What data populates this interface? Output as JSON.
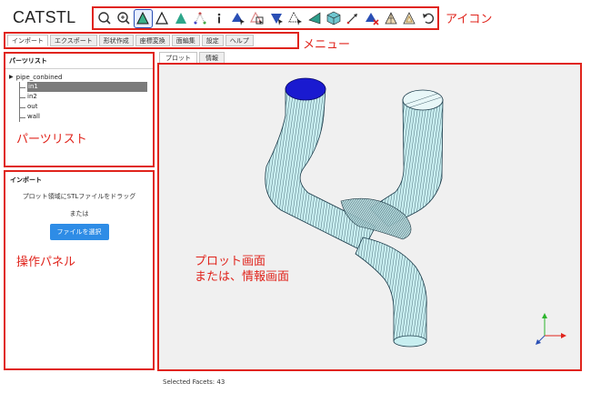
{
  "app": {
    "title": "CATSTL"
  },
  "toolbar": {
    "icons": [
      "zoom-fit-icon",
      "zoom-icon",
      "view-triangle-active-icon",
      "wireframe-triangle-icon",
      "shaded-triangle-icon",
      "point-triangle-icon",
      "info-icon",
      "select-face-icon",
      "select-box-icon",
      "select-flag-icon",
      "select-point-icon",
      "solid-triangle-icon",
      "cube-icon",
      "arrow-icon",
      "delete-face-icon",
      "triangle-mesh-icon",
      "triangle-outline-icon",
      "undo-icon"
    ]
  },
  "menu": {
    "tabs": [
      "インポート",
      "エクスポート",
      "形状作成",
      "座標変換",
      "面編集",
      "設定",
      "ヘルプ"
    ]
  },
  "parts": {
    "header": "パーツリスト",
    "root": "pipe_conbined",
    "items": [
      "in1",
      "in2",
      "out",
      "wall"
    ]
  },
  "import_panel": {
    "title": "インポート",
    "drop_text": "プロット領域にSTLファイルをドラッグ",
    "or_text": "または",
    "button_label": "ファイルを選択"
  },
  "plot": {
    "tabs": [
      "プロット",
      "情報"
    ],
    "mesh_fill": "#c8eef0",
    "mesh_line": "#1b3b4a",
    "selected_color": "#1a1ad0"
  },
  "status": {
    "text": "Selected Facets: 43"
  },
  "annotations": {
    "icons": "アイコン",
    "menu": "メニュー",
    "parts": "パーツリスト",
    "ops": "操作パネル",
    "plot_line1": "プロット画面",
    "plot_line2": "または、情報画面"
  }
}
